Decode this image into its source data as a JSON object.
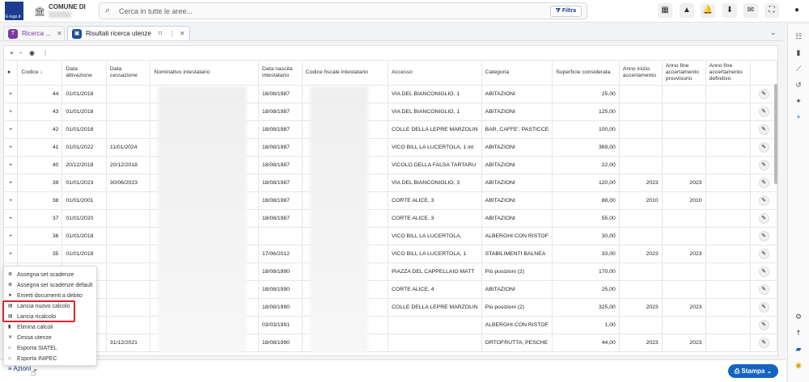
{
  "header": {
    "comune_label": "COMUNE DI",
    "search_placeholder": "Cerca in tutte le aree...",
    "filter_label": "Filtra",
    "logo_text": "E-lugo.it"
  },
  "tabs": [
    {
      "label": "Ricerca ..."
    },
    {
      "label": "Risultati ricerca utenze"
    }
  ],
  "toolbar": {
    "add": "+",
    "view": "◉"
  },
  "columns": [
    "Codice",
    "Data attivazione",
    "Data cessazione",
    "Nominativo intestatario",
    "Data nascita intestatario",
    "Codice fiscale intestatario",
    "Accesso",
    "Categoria",
    "Superficie considerata",
    "Anno inizio accertamento",
    "Anno fine accertamento provvisorio",
    "Anno fine accertamento definitivo"
  ],
  "rows": [
    {
      "codice": "44",
      "att": "01/01/2018",
      "cess": "",
      "nascita": "18/08/1987",
      "accesso": "VIA DEL BIANCONIGLIO, 1",
      "categoria": "ABITAZIONI",
      "sup": "25,00",
      "ini": "",
      "prov": ""
    },
    {
      "codice": "43",
      "att": "01/01/2018",
      "cess": "",
      "nascita": "18/08/1987",
      "accesso": "VIA DEL BIANCONIGLIO, 1",
      "categoria": "ABITAZIONI",
      "sup": "125,00",
      "ini": "",
      "prov": ""
    },
    {
      "codice": "42",
      "att": "01/01/2018",
      "cess": "",
      "nascita": "18/08/1987",
      "accesso": "COLLE DELLA LEPRE MARZOLIN",
      "categoria": "BAR, CAFFE', PASTICCE",
      "sup": "100,00",
      "ini": "",
      "prov": ""
    },
    {
      "codice": "41",
      "att": "01/01/2022",
      "cess": "11/01/2024",
      "nascita": "18/08/1987",
      "accesso": "VICO BILL LA LUCERTOLA, 1 int",
      "categoria": "ABITAZIONI",
      "sup": "369,00",
      "ini": "",
      "prov": ""
    },
    {
      "codice": "40",
      "att": "20/12/2018",
      "cess": "20/12/2018",
      "nascita": "18/08/1987",
      "accesso": "VICOLO DELLA FALSA TARTARU",
      "categoria": "ABITAZIONI",
      "sup": "22,00",
      "ini": "",
      "prov": ""
    },
    {
      "codice": "39",
      "att": "01/01/2023",
      "cess": "30/06/2023",
      "nascita": "18/08/1987",
      "accesso": "VIA DEL BIANCONIGLIO, 3",
      "categoria": "ABITAZIONI",
      "sup": "120,00",
      "ini": "2023",
      "prov": "2023"
    },
    {
      "codice": "38",
      "att": "01/01/2001",
      "cess": "",
      "nascita": "18/08/1987",
      "accesso": "CORTE ALICE, 3",
      "categoria": "ABITAZIONI",
      "sup": "88,00",
      "ini": "2010",
      "prov": "2010"
    },
    {
      "codice": "37",
      "att": "01/01/2020",
      "cess": "",
      "nascita": "18/08/1987",
      "accesso": "CORTE ALICE, 3",
      "categoria": "ABITAZIONI",
      "sup": "55,00",
      "ini": "",
      "prov": ""
    },
    {
      "codice": "36",
      "att": "01/01/2018",
      "cess": "",
      "nascita": "",
      "accesso": "VICO BILL LA LUCERTOLA,",
      "categoria": "ALBERGHI CON RISTOF",
      "sup": "30,00",
      "ini": "",
      "prov": ""
    },
    {
      "codice": "35",
      "att": "01/01/2018",
      "cess": "",
      "nascita": "17/06/2012",
      "accesso": "VICO BILL LA LUCERTOLA, 1",
      "categoria": "STABILIMENTI BALNEA",
      "sup": "33,00",
      "ini": "2023",
      "prov": "2023"
    },
    {
      "codice": "",
      "att": "",
      "cess": "",
      "nascita": "18/08/1990",
      "accesso": "PIAZZA DEL CAPPELLAIO MATT",
      "categoria": "Più posizioni (2)",
      "sup": "170,00",
      "ini": "",
      "prov": ""
    },
    {
      "codice": "",
      "att": "",
      "cess": "",
      "nascita": "18/08/1990",
      "accesso": "CORTE ALICE, 4",
      "categoria": "ABITAZIONI",
      "sup": "25,00",
      "ini": "",
      "prov": ""
    },
    {
      "codice": "",
      "att": "",
      "cess": "",
      "nascita": "18/08/1990",
      "accesso": "COLLE DELLA LEPRE MARZOLIN",
      "categoria": "Più posizioni (2)",
      "sup": "325,00",
      "ini": "2023",
      "prov": "2023"
    },
    {
      "codice": "",
      "att": "",
      "cess": "",
      "nascita": "03/03/1991",
      "accesso": "",
      "categoria": "ALBERGHI CON RISTOF",
      "sup": "1,00",
      "ini": "",
      "prov": ""
    },
    {
      "codice": "",
      "att": "",
      "cess": "31/12/2021",
      "nascita": "18/08/1990",
      "accesso": "",
      "categoria": "ORTOFRUTTA, PESCHE",
      "sup": "44,00",
      "ini": "2023",
      "prov": "2023"
    }
  ],
  "menu": [
    {
      "icon": "≣",
      "label": "Assegna set scadenze"
    },
    {
      "icon": "≣",
      "label": "Assegna set scadenze default"
    },
    {
      "icon": "➤",
      "label": "Emetti documenti a debito"
    },
    {
      "icon": "▤",
      "label": "Lancia nuovo calcolo"
    },
    {
      "icon": "▤",
      "label": "Lancia ricalcolo"
    },
    {
      "icon": "▮",
      "label": "Elimina calcoli"
    },
    {
      "icon": "✕",
      "label": "Cessa utenze"
    },
    {
      "icon": "⌂",
      "label": "Esporta SIATEL"
    },
    {
      "icon": "⌂",
      "label": "Esporta INIPEC"
    }
  ],
  "bottom": {
    "azioni": "Azioni",
    "stampa": "Stampa"
  }
}
